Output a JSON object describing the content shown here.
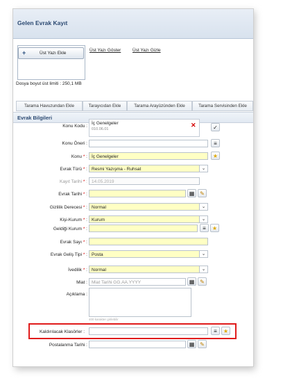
{
  "window_title": "Gelen Evrak Kayıt",
  "upload": {
    "button_label": "Üst Yazı Ekle",
    "show_link": "Üst Yazı Göster",
    "hide_link": "Üst Yazı Gizle",
    "limit_text": "Dosya boyut üst limiti : 250,1 MB"
  },
  "tabs": [
    "Tarama Havuzundan Ekle",
    "Tarayıcıdan Ekle",
    "Tarama Arayüzünden Ekle",
    "Tarama Servisinden Ekle"
  ],
  "section_title": "Evrak Bilgileri",
  "form": {
    "konu_kodu": {
      "label": "Konu Kodu :",
      "name": "İç Genelgeler",
      "code": "010.06.01"
    },
    "konu_oneri": {
      "label": "Konu Öneri :"
    },
    "konu": {
      "label": "Konu",
      "value": "İç Genelgeler"
    },
    "evrak_turu": {
      "label": "Evrak Türü",
      "value": "Resmi Yazışma - Ruhsat"
    },
    "kayit_tarihi": {
      "label": "Kayıt Tarihi",
      "value": "14.05.2019"
    },
    "evrak_tarihi": {
      "label": "Evrak Tarihi"
    },
    "gizlilik": {
      "label": "Gizlilik Derecesi",
      "value": "Normal"
    },
    "kisi_kurum": {
      "label": "Kişi-Kurum",
      "value": "Kurum"
    },
    "geldigi_kurum": {
      "label": "Geldiği Kurum"
    },
    "evrak_sayi": {
      "label": "Evrak Sayı"
    },
    "gelis_tipi": {
      "label": "Evrak Geliş Tipi",
      "value": "Posta"
    },
    "ivedilik": {
      "label": "İvedilik",
      "value": "Normal"
    },
    "miat": {
      "label": "Miat :",
      "placeholder": "Miat Tarihi GG.AA.YYYY"
    },
    "aciklama": {
      "label": "Açıklama :",
      "counter": "400 karakter girilebilir"
    },
    "klasorler": {
      "label": "Kaldırılacak Klasörler :"
    },
    "postalanma": {
      "label": "Postalanma Tarihi :"
    }
  },
  "colors": {
    "required": "#d40000",
    "highlight": "#e01b1b",
    "title": "#2c4a72"
  }
}
